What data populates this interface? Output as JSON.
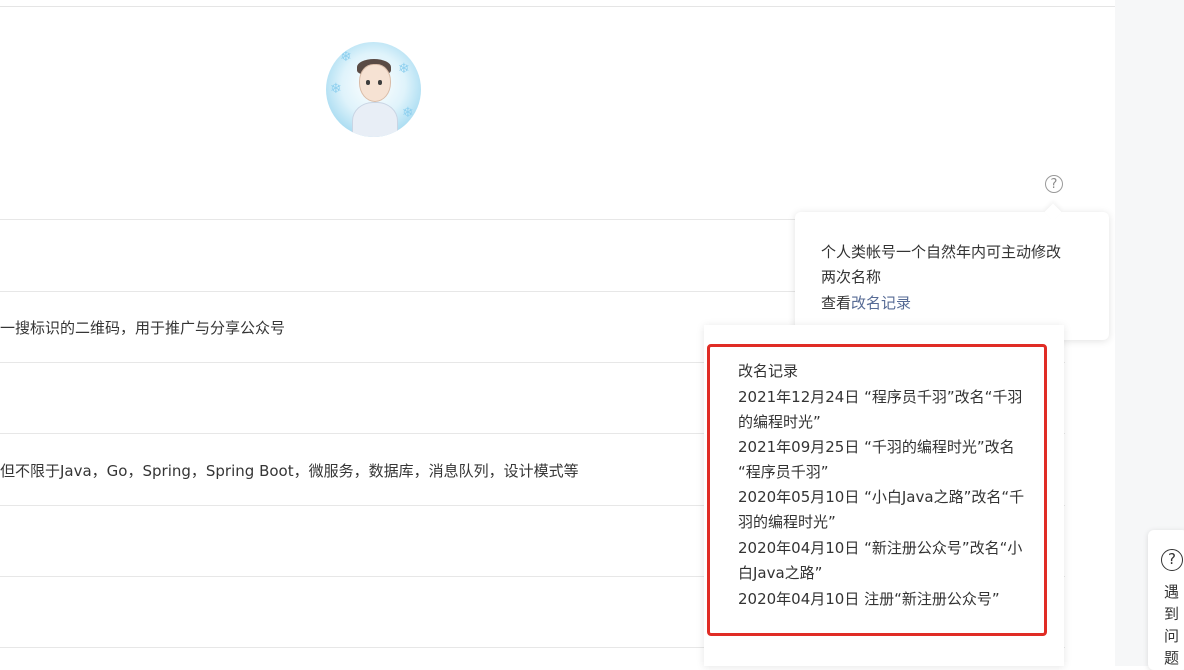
{
  "rows": {
    "qr_description": "一搜标识的二维码，用于推广与分享公众号",
    "intro_text": "但不限于Java，Go，Spring，Spring Boot，微服务，数据库，消息队列，设计模式等"
  },
  "name_tooltip": {
    "line1": "个人类帐号一个自然年内可主动修改",
    "line2": "两次名称",
    "view_prefix": "查看",
    "view_link": "改名记录"
  },
  "rename_history": {
    "title": "改名记录",
    "lines": [
      "2021年12月24日 “程序员千羽”改名“千羽",
      "的编程时光”",
      "2021年09月25日 “千羽的编程时光”改名",
      "“程序员千羽”",
      "2020年05月10日 “小白Java之路”改名“千",
      "羽的编程时光”",
      "2020年04月10日 “新注册公众号”改名“小",
      "白Java之路”",
      "2020年04月10日 注册“新注册公众号”"
    ]
  },
  "help_panel": {
    "icon_glyph": "?",
    "label": "遇到问题"
  },
  "icons": {
    "help": "?"
  },
  "colors": {
    "link": "#576b95",
    "highlight_border": "#e02c25",
    "gutter": "#f6f7f8"
  }
}
